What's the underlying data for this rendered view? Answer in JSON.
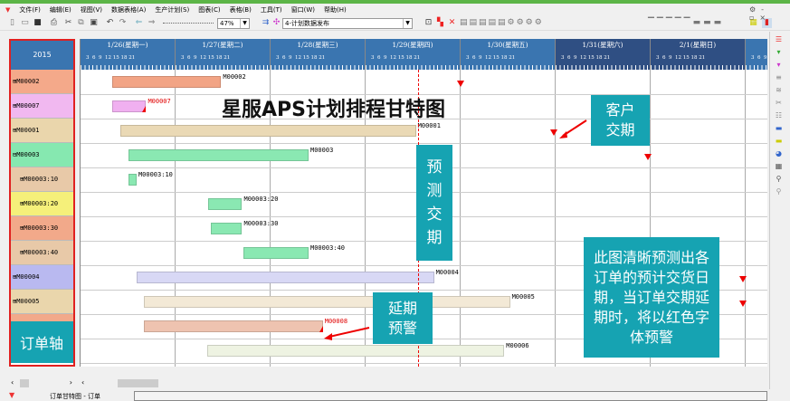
{
  "menu": [
    "文件(F)",
    "编辑(E)",
    "视图(V)",
    "数据表格(A)",
    "生产计划(S)",
    "图表(C)",
    "表格(B)",
    "工具(T)",
    "窗口(W)",
    "帮助(H)"
  ],
  "toolbar": {
    "zoom": "47%",
    "plan": "4-计划数据发布"
  },
  "year": "2015",
  "days": [
    {
      "label": "1/26(星期一)",
      "weekend": false
    },
    {
      "label": "1/27(星期二)",
      "weekend": false
    },
    {
      "label": "1/28(星期三)",
      "weekend": false
    },
    {
      "label": "1/29(星期四)",
      "weekend": false
    },
    {
      "label": "1/30(星期五)",
      "weekend": false
    },
    {
      "label": "1/31(星期六)",
      "weekend": true
    },
    {
      "label": "2/1(星期日)",
      "weekend": true
    },
    {
      "label": "",
      "weekend": false
    }
  ],
  "hours": "3  6  9  12 15 18 21",
  "rows": [
    {
      "label": "⊞M00002",
      "sub": false,
      "color": "#f4a98a"
    },
    {
      "label": "⊞M00007",
      "sub": false,
      "color": "#f1b8f0"
    },
    {
      "label": "⊞M00001",
      "sub": false,
      "color": "#ead6ac"
    },
    {
      "label": "⊟M00003",
      "sub": false,
      "color": "#86e8b0"
    },
    {
      "label": "⊞M00003:10",
      "sub": true,
      "color": "#e8c9a8"
    },
    {
      "label": "⊞M00003:20",
      "sub": true,
      "color": "#f5f07a"
    },
    {
      "label": "⊞M00003:30",
      "sub": true,
      "color": "#f2a98a"
    },
    {
      "label": "⊞M00003:40",
      "sub": true,
      "color": "#e8c9a8"
    },
    {
      "label": "⊞M00004",
      "sub": false,
      "color": "#b9b9f0"
    },
    {
      "label": "⊞M00005",
      "sub": false,
      "color": "#ead6ac"
    },
    {
      "label": "⊞M00008",
      "sub": false,
      "color": "#f2a98a"
    },
    {
      "label": "⊞M00006",
      "sub": false,
      "color": "#dfe8c8"
    }
  ],
  "bars": [
    {
      "label": "M00002",
      "row": 0,
      "start": 0.33,
      "end": 1.48,
      "color": "#f2a485",
      "red": false
    },
    {
      "label": "M00007",
      "row": 1,
      "start": 0.33,
      "end": 0.69,
      "color": "#f0b0f0",
      "red": true
    },
    {
      "label": "M00001",
      "row": 2,
      "start": 0.42,
      "end": 3.53,
      "color": "#ead9b5",
      "red": false
    },
    {
      "label": "M00003",
      "row": 3,
      "start": 0.5,
      "end": 2.4,
      "color": "#8ae8b2",
      "red": false
    },
    {
      "label": "M00003:10",
      "row": 4,
      "start": 0.5,
      "end": 0.59,
      "color": "#8ae8b2",
      "red": false
    },
    {
      "label": "M00003:20",
      "row": 5,
      "start": 1.34,
      "end": 1.7,
      "color": "#8ae8b2",
      "red": false
    },
    {
      "label": "M00003:30",
      "row": 6,
      "start": 1.37,
      "end": 1.7,
      "color": "#8ae8b2",
      "red": false
    },
    {
      "label": "M00003:40",
      "row": 7,
      "start": 1.71,
      "end": 2.4,
      "color": "#8ae8b2",
      "red": false
    },
    {
      "label": "M00004",
      "row": 8,
      "start": 0.59,
      "end": 3.72,
      "color": "#d8d8f5",
      "red": false
    },
    {
      "label": "M00005",
      "row": 9,
      "start": 0.67,
      "end": 4.52,
      "color": "#f3e9d6",
      "red": false
    },
    {
      "label": "M00008",
      "row": 10,
      "start": 0.67,
      "end": 2.55,
      "color": "#eec3b0",
      "red": true
    },
    {
      "label": "M00006",
      "row": 11,
      "start": 1.33,
      "end": 4.46,
      "color": "#eef3e2",
      "red": false
    }
  ],
  "due_markers": [
    {
      "row": 0,
      "day": 4.0
    },
    {
      "row": 2,
      "day": 4.98
    },
    {
      "row": 3,
      "day": 5.97
    },
    {
      "row": 8,
      "day": 6.97
    },
    {
      "row": 9,
      "day": 6.97
    }
  ],
  "forecast_line_day": 3.55,
  "annotations": {
    "title": "星服APS计划排程甘特图",
    "customer_due": "客户\n交期",
    "forecast_due": "预\n测\n交\n期",
    "delay_warning": "延期\n预警",
    "explanation": "此图清晰预测出各订单的预计交货日期，当订单交期延期时，将以红色字体预警",
    "order_axis": "订单轴"
  },
  "status": {
    "tab": "订单甘特图 - 订单"
  },
  "colors": {
    "header": "#3a75b0",
    "weekend": "#2f4f83",
    "teal": "#16a3b2",
    "alert": "#e00000"
  }
}
